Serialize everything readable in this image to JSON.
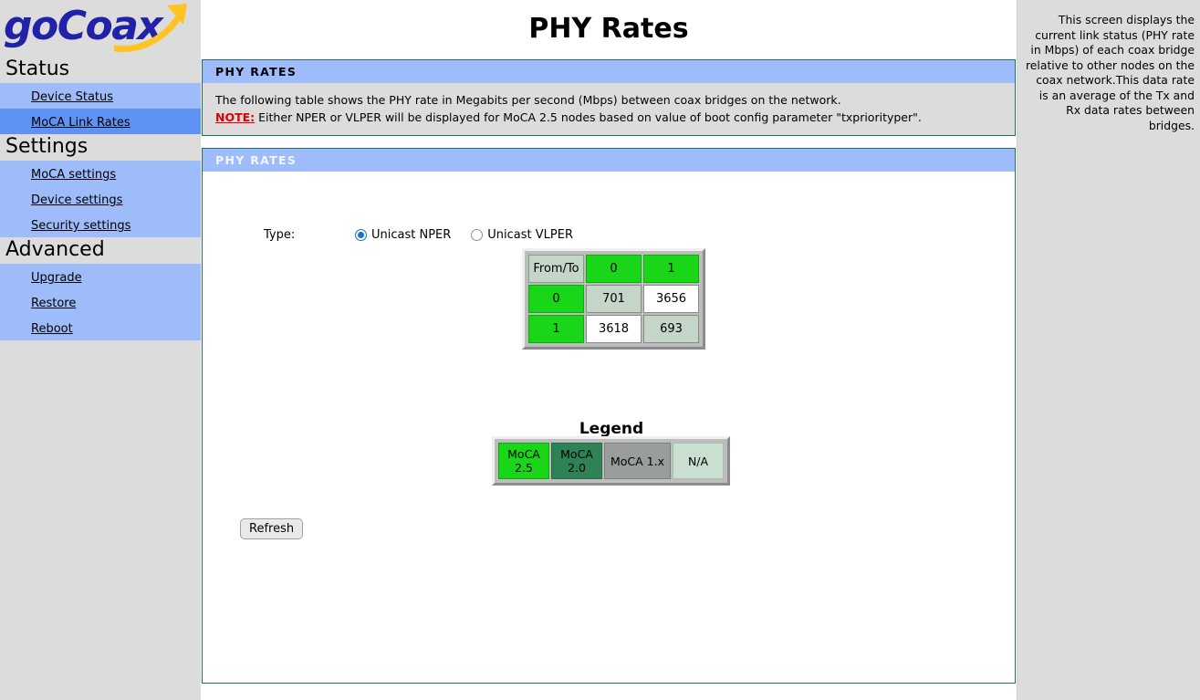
{
  "brand": {
    "name": "goCoax",
    "logo_arrow_icon": "swoosh-arrow-icon",
    "text_color": "#2222a8",
    "arrow_color": "#ffc423"
  },
  "sidebar": {
    "groups": [
      {
        "title": "Status",
        "items": [
          {
            "label": "Device Status",
            "active": false
          },
          {
            "label": "MoCA Link Rates",
            "active": true
          }
        ]
      },
      {
        "title": "Settings",
        "items": [
          {
            "label": "MoCA settings",
            "active": false
          },
          {
            "label": "Device settings",
            "active": false
          },
          {
            "label": "Security settings",
            "active": false
          }
        ]
      },
      {
        "title": "Advanced",
        "items": [
          {
            "label": "Upgrade",
            "active": false
          },
          {
            "label": "Restore",
            "active": false
          },
          {
            "label": "Reboot",
            "active": false
          }
        ]
      }
    ],
    "active_bg": "#5e93f5",
    "item_bg": "#9ebcfa"
  },
  "page": {
    "title": "PHY Rates"
  },
  "info_panel": {
    "header": "PHY RATES",
    "description": "The following table shows the PHY rate in Megabits per second (Mbps) between coax bridges on the network.",
    "note_label": "NOTE:",
    "note_text": "Either NPER or VLPER will be displayed for MoCA 2.5 nodes based on value of boot config parameter \"txpriorityper\".",
    "note_color": "#e00000"
  },
  "rates_panel": {
    "header": "PHY RATES",
    "type_label": "Type:",
    "type_options": [
      {
        "label": "Unicast NPER",
        "selected": true
      },
      {
        "label": "Unicast VLPER",
        "selected": false
      }
    ]
  },
  "chart_data": {
    "type": "table",
    "title": "PHY Rates",
    "corner_label": "From/To",
    "columns": [
      "0",
      "1"
    ],
    "rows": [
      "0",
      "1"
    ],
    "unit": "Mbps",
    "cells": [
      [
        {
          "value": "701",
          "kind": "self"
        },
        {
          "value": "3656",
          "kind": "link"
        }
      ],
      [
        {
          "value": "3618",
          "kind": "link"
        },
        {
          "value": "693",
          "kind": "self"
        }
      ]
    ]
  },
  "legend": {
    "title": "Legend",
    "entries": [
      {
        "label": "MoCA\n2.5",
        "color": "#19d619",
        "kind": "m25"
      },
      {
        "label": "MoCA\n2.0",
        "color": "#2f8256",
        "kind": "m20"
      },
      {
        "label": "MoCA 1.x",
        "color": "#9a9e9a",
        "kind": "m1x"
      },
      {
        "label": "N/A",
        "color": "#c9dfd0",
        "kind": "na"
      }
    ]
  },
  "actions": {
    "refresh_label": "Refresh"
  },
  "help": {
    "text": "This screen displays the current link status (PHY rate in Mbps) of each coax bridge relative to other nodes on the coax network.This data rate is an average of the Tx and Rx data rates between bridges."
  }
}
